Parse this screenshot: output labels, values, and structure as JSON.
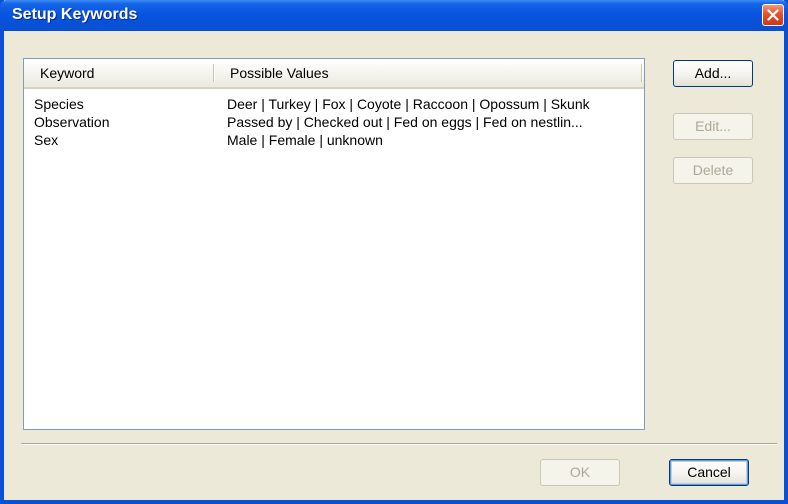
{
  "window": {
    "title": "Setup Keywords"
  },
  "listview": {
    "columns": [
      "Keyword",
      "Possible Values"
    ],
    "rows": [
      {
        "keyword": "Species",
        "values": "Deer | Turkey | Fox | Coyote | Raccoon | Opossum | Skunk"
      },
      {
        "keyword": "Observation",
        "values": "Passed by | Checked out | Fed on eggs | Fed on nestlin..."
      },
      {
        "keyword": "Sex",
        "values": "Male | Female | unknown"
      }
    ]
  },
  "buttons": {
    "add": "Add...",
    "edit": "Edit...",
    "delete": "Delete",
    "ok": "OK",
    "cancel": "Cancel"
  },
  "colors": {
    "titlebar": "#0a56e0",
    "dialog_bg": "#ece9d8",
    "close_button": "#e4512b",
    "disabled_text": "#aca899"
  },
  "icons": {
    "close": "close-x-icon"
  }
}
